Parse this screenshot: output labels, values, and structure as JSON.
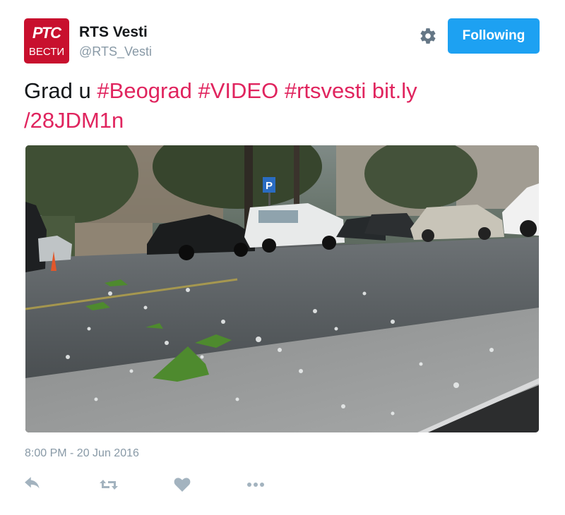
{
  "account": {
    "name": "RTS Vesti",
    "handle": "@RTS_Vesti",
    "avatar_logo_top": "РТС",
    "avatar_logo_bottom": "ВЕСТИ",
    "avatar_color": "#c8102e"
  },
  "header": {
    "settings_icon": "gear-icon",
    "follow_button_label": "Following"
  },
  "tweet": {
    "text_plain": "Grad u",
    "hashtag_1": "#Beograd",
    "hashtag_2": "#VIDEO",
    "hashtag_3": "#rtsvesti",
    "link_part_1": "bit.ly",
    "link_part_2": "/28JDM1n",
    "timestamp": "8:00 PM - 20 Jun 2016"
  },
  "media": {
    "description_icon": "photo",
    "parking_sign": "P"
  },
  "actions": {
    "reply_icon": "reply-icon",
    "retweet_icon": "retweet-icon",
    "like_icon": "heart-icon",
    "more_icon": "more-icon"
  },
  "colors": {
    "accent": "#1da1f2",
    "link": "#e0245e",
    "muted": "#8899a6",
    "text": "#14171a"
  }
}
